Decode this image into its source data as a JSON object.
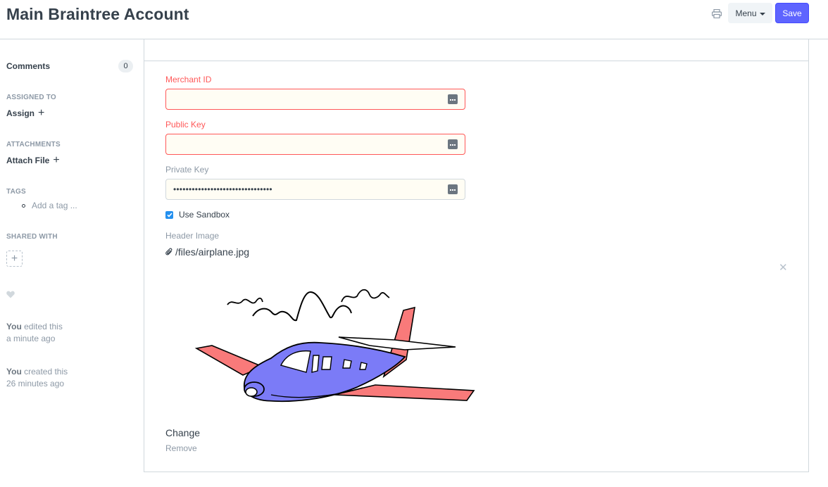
{
  "header": {
    "title": "Main Braintree Account",
    "menu_label": "Menu",
    "save_label": "Save"
  },
  "sidebar": {
    "comments_label": "Comments",
    "comments_count": "0",
    "assigned_to_label": "ASSIGNED TO",
    "assign_label": "Assign",
    "attachments_label": "ATTACHMENTS",
    "attach_file_label": "Attach File",
    "tags_label": "TAGS",
    "add_tag_placeholder": "Add a tag ...",
    "shared_with_label": "SHARED WITH",
    "activity": [
      {
        "who": "You",
        "action": " edited this",
        "when": "a minute ago"
      },
      {
        "who": "You",
        "action": " created this",
        "when": "26 minutes ago"
      }
    ]
  },
  "form": {
    "merchant_id": {
      "label": "Merchant ID",
      "value": ""
    },
    "public_key": {
      "label": "Public Key",
      "value": ""
    },
    "private_key": {
      "label": "Private Key",
      "value": "••••••••••••••••••••••••••••••••"
    },
    "use_sandbox": {
      "label": "Use Sandbox",
      "checked": true
    },
    "header_image": {
      "label": "Header Image",
      "file_path": "/files/airplane.jpg",
      "change_label": "Change",
      "remove_label": "Remove"
    }
  },
  "colors": {
    "primary": "#5e64ff",
    "error": "#ff5858",
    "input_bg": "#fffdf4",
    "checkbox": "#2490ef"
  },
  "icons": {
    "print": "printer-icon",
    "close": "close-icon",
    "attachment": "paperclip-icon",
    "like": "heart-icon",
    "password": "password-dots-icon"
  }
}
